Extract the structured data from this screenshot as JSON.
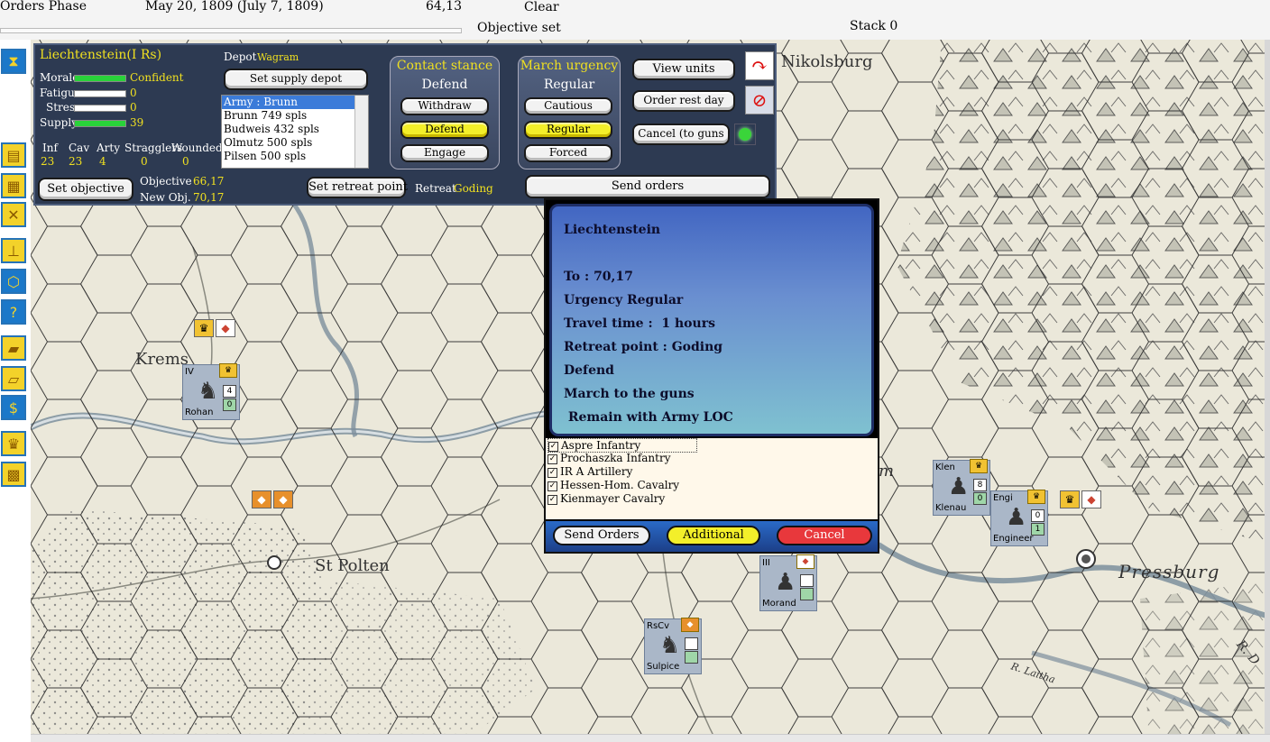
{
  "topbar": {
    "phase": "Orders Phase",
    "date": "May 20, 1809 (July 7, 1809)",
    "coords": "64,13",
    "weather": "Clear",
    "objective_status": "Objective set",
    "stack": "Stack 0"
  },
  "toolbar": {
    "icons": [
      "hourglass-icon",
      "report-icon",
      "supply-icon",
      "battle-icon",
      "organization-icon",
      "hex-icon",
      "help-icon",
      "reinforcement-icon",
      "transfer-icon",
      "money-icon",
      "leader-icon",
      "fortify-icon"
    ]
  },
  "panel": {
    "commander": "Liechtenstein(I Rs)",
    "morale_label": "Morale",
    "morale_value": "Confident",
    "fatigue_label": "Fatigue",
    "fatigue_value": "0",
    "stress_label": "Stress",
    "stress_value": "0",
    "supply_label": "Supply",
    "supply_value": "39",
    "stats_headers": [
      "Inf",
      "Cav",
      "Arty",
      "Stragglers",
      "Wounded"
    ],
    "stats_values": [
      "23",
      "23",
      "4",
      "0",
      "0"
    ],
    "set_objective": "Set objective",
    "objective_label": "Objective",
    "objective_value": "66,17",
    "new_obj_label": "New Obj.",
    "new_obj_value": "70,17",
    "depot_label": "Depot",
    "depot_value": "Wagram",
    "set_supply_depot": "Set supply depot",
    "depots": [
      "Army : Brunn",
      "Brunn 749 spls",
      "Budweis 432 spls",
      "Olmutz 500 spls",
      "Pilsen 500 spls"
    ],
    "set_retreat_point": "Set retreat point",
    "retreat_label": "Retreat",
    "retreat_value": "Goding",
    "contact_title": "Contact stance",
    "contact_value": "Defend",
    "contact_buttons": [
      "Withdraw",
      "Defend",
      "Engage"
    ],
    "march_title": "March urgency",
    "march_value": "Regular",
    "march_buttons": [
      "Cautious",
      "Regular",
      "Forced"
    ],
    "view_units": "View units",
    "order_rest_day": "Order rest day",
    "cancel_to_guns": "Cancel (to guns",
    "send_orders": "Send orders"
  },
  "popup": {
    "commander": "Liechtenstein",
    "lines": [
      "To : 70,17",
      "Urgency Regular",
      "Travel time :  1 hours",
      "Retreat point : Goding",
      "Defend",
      "March to the guns",
      " Remain with Army LOC"
    ],
    "units": [
      "Aspre Infantry",
      "Prochaszka Infantry",
      "IR A Artillery",
      "Hessen-Hom. Cavalry",
      "Kienmayer Cavalry"
    ],
    "btn_send": "Send Orders",
    "btn_additional": "Additional",
    "btn_cancel": "Cancel"
  },
  "map": {
    "places": [
      "Nikolsburg",
      "Krems",
      "St Polten",
      "Pressburg",
      "m",
      "R. Laitha",
      "R. D"
    ],
    "counters": [
      {
        "id": "IV",
        "name": "Rohan",
        "v1": "4",
        "v2": "0"
      },
      {
        "id": "Klen",
        "name": "Klenau",
        "v1": "8",
        "v2": "0"
      },
      {
        "id": "Engi",
        "name": "Engineer",
        "v1": "0",
        "v2": "1"
      },
      {
        "id": "III",
        "name": "Morand",
        "v1": "",
        "v2": ""
      },
      {
        "id": "RsCv",
        "name": "Sulpice",
        "v1": "",
        "v2": ""
      }
    ]
  },
  "colors": {
    "panel_bg": "#2d3a52",
    "accent_yellow": "#f0e020",
    "supply_green": "#29d23a",
    "cancel_red": "#e8383c"
  }
}
